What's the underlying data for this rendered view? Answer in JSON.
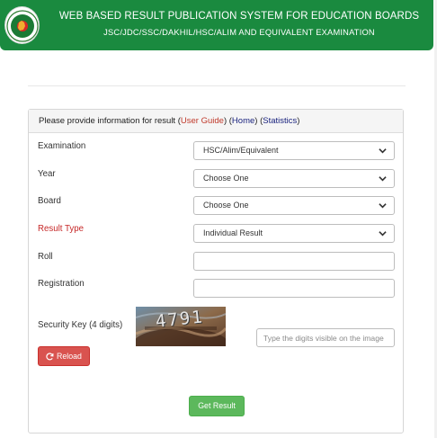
{
  "header": {
    "title": "WEB BASED RESULT PUBLICATION SYSTEM FOR EDUCATION BOARDS",
    "subtitle": "JSC/JDC/SSC/DAKHIL/HSC/ALIM AND EQUIVALENT EXAMINATION",
    "brand_color": "#1a8a3f",
    "logo_icon": "bangladesh-government-seal-icon"
  },
  "panel": {
    "intro": "Please provide information for result",
    "open_paren_1": " (",
    "user_guide": "User Guide",
    "close_open_1": ") (",
    "home": "Home",
    "close_open_2": ") (",
    "statistics": "Statistics",
    "close_paren": ")"
  },
  "form": {
    "examination_label": "Examination",
    "examination_value": "HSC/Alim/Equivalent",
    "year_label": "Year",
    "year_value": "Choose One",
    "board_label": "Board",
    "board_value": "Choose One",
    "result_type_label": "Result Type",
    "result_type_value": "Individual Result",
    "roll_label": "Roll",
    "roll_value": "",
    "registration_label": "Registration",
    "registration_value": "",
    "security_label": "Security Key (4 digits)",
    "captcha_text": "4791",
    "security_placeholder": "Type the digits visible on the image",
    "reload_label": "Reload",
    "submit_label": "Get Result"
  },
  "colors": {
    "reload_button": "#d9534f",
    "submit_button": "#5cb85c",
    "user_guide_link": "#c0392b",
    "home_link": "#1a237e",
    "result_type_label": "#c62828"
  }
}
